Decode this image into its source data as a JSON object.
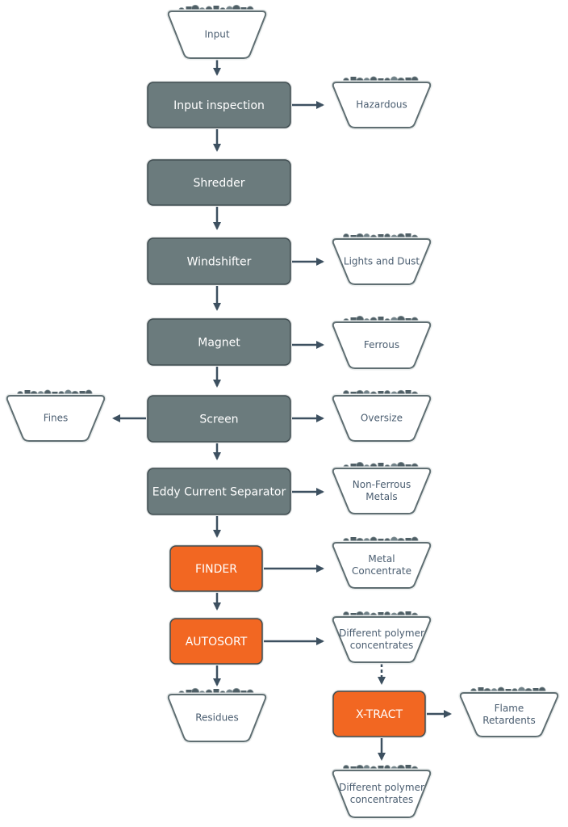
{
  "colors": {
    "process_gray": "#6b7b7d",
    "process_orange": "#f26722",
    "arrow": "#3d5060",
    "container_stroke": "#5f6e72",
    "container_text": "#4a5d70",
    "rubble": "#4f5f66"
  },
  "processes": {
    "input_inspection": "Input inspection",
    "shredder": "Shredder",
    "windshifter": "Windshifter",
    "magnet": "Magnet",
    "screen": "Screen",
    "eddy": "Eddy Current Separator",
    "finder": "FINDER",
    "autosort": "AUTOSORT",
    "xtract": "X-TRACT"
  },
  "outputs": {
    "input": [
      "Input"
    ],
    "hazardous": [
      "Hazardous"
    ],
    "lights_dust": [
      "Lights and Dust"
    ],
    "ferrous": [
      "Ferrous"
    ],
    "fines": [
      "Fines"
    ],
    "oversize": [
      "Oversize"
    ],
    "non_ferrous": [
      "Non-Ferrous",
      "Metals"
    ],
    "metal_concentrate": [
      "Metal",
      "Concentrate"
    ],
    "polymer1": [
      "Different polymer",
      "concentrates"
    ],
    "residues": [
      "Residues"
    ],
    "flame": [
      "Flame",
      "Retardents"
    ],
    "polymer2": [
      "Different polymer",
      "concentrates"
    ]
  }
}
